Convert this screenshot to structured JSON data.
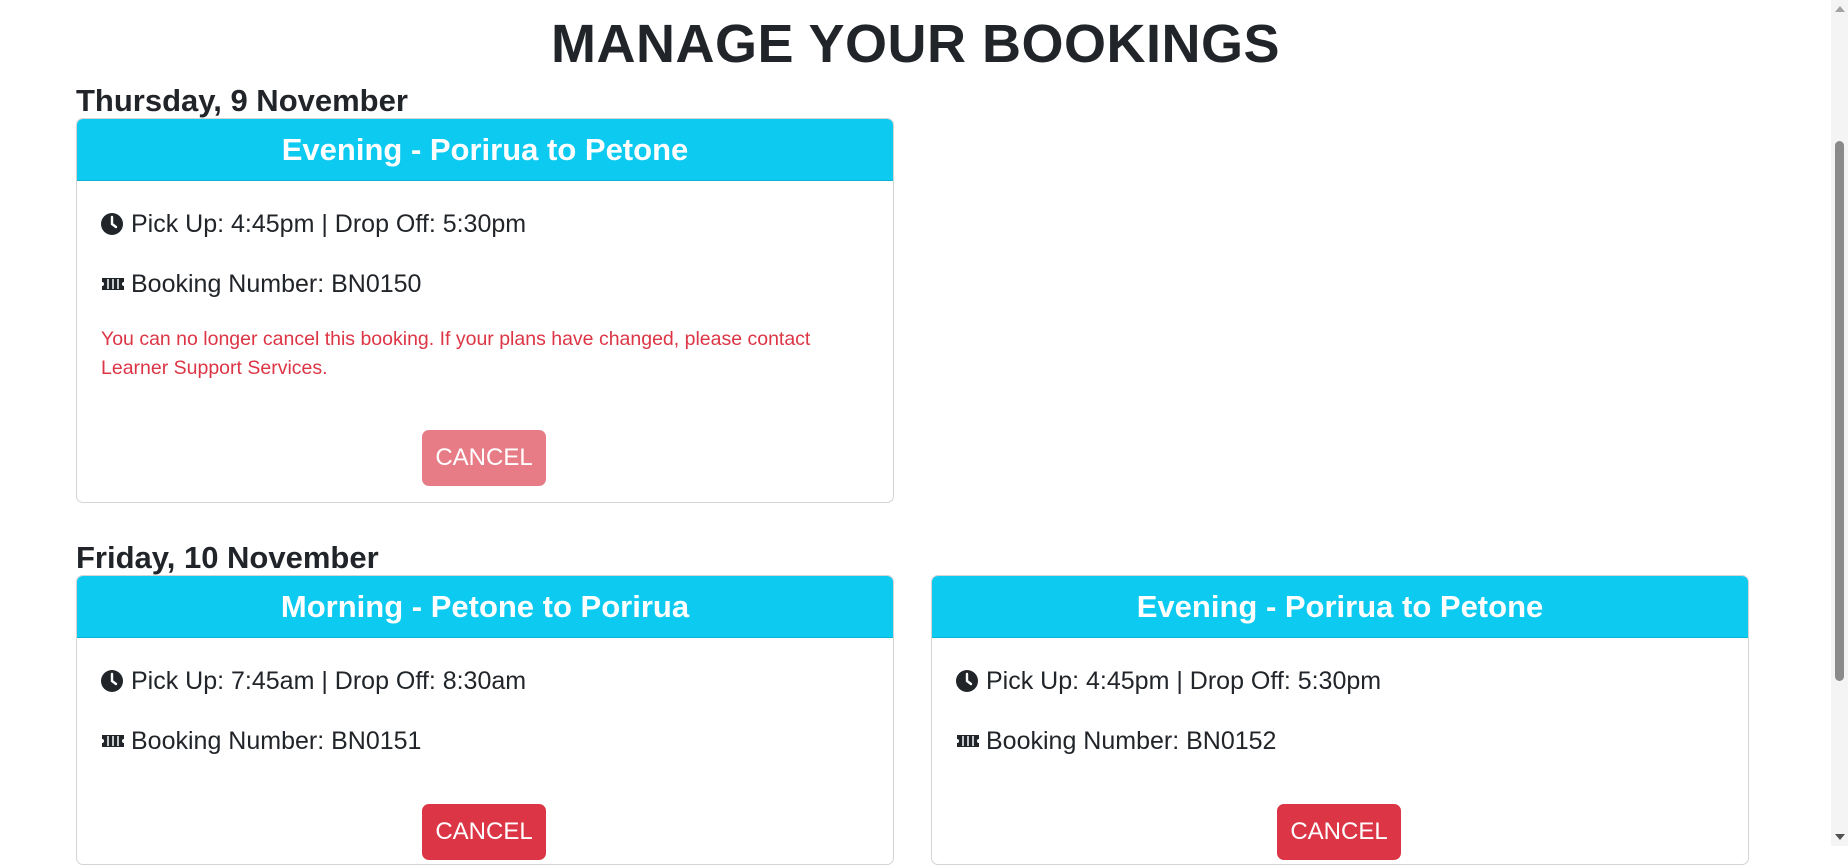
{
  "page": {
    "title": "MANAGE YOUR BOOKINGS"
  },
  "labels": {
    "pickup_prefix": "Pick Up:",
    "dropoff_prefix": "Drop Off:",
    "booking_prefix": "Booking Number:"
  },
  "days": [
    {
      "heading": "Thursday, 9 November",
      "bookings": [
        {
          "title": "Evening - Porirua to Petone",
          "times": "Pick Up: 4:45pm | Drop Off: 5:30pm",
          "booking_number": "Booking Number: BN0150",
          "notice": "You can no longer cancel this booking. If your plans have changed, please contact Learner Support Services.",
          "cancel_label": "CANCEL",
          "cancel_enabled": false
        }
      ]
    },
    {
      "heading": "Friday, 10 November",
      "bookings": [
        {
          "title": "Morning - Petone to Porirua",
          "times": "Pick Up: 7:45am | Drop Off: 8:30am",
          "booking_number": "Booking Number: BN0151",
          "cancel_label": "CANCEL",
          "cancel_enabled": true
        },
        {
          "title": "Evening - Porirua to Petone",
          "times": "Pick Up: 4:45pm | Drop Off: 5:30pm",
          "booking_number": "Booking Number: BN0152",
          "cancel_label": "CANCEL",
          "cancel_enabled": true
        }
      ]
    }
  ],
  "icons": {
    "time": "clock-icon",
    "booking": "ticket-icon"
  },
  "colors": {
    "header_bg": "#0dcaf0",
    "danger": "#dc3545",
    "danger_disabled": "#e77c86",
    "text": "#212529"
  }
}
